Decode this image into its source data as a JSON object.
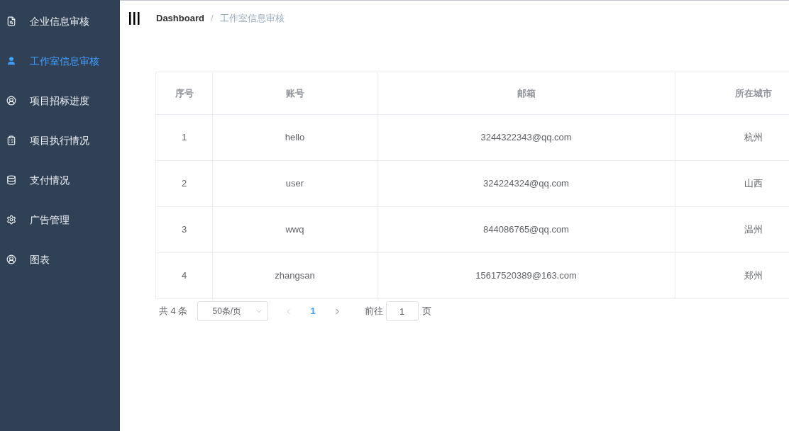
{
  "sidebar": {
    "items": [
      {
        "label": "企业信息审核",
        "selected": false
      },
      {
        "label": "工作室信息审核",
        "selected": true
      },
      {
        "label": "项目招标进度",
        "selected": false
      },
      {
        "label": "项目执行情况",
        "selected": false
      },
      {
        "label": "支付情况",
        "selected": false
      },
      {
        "label": "广告管理",
        "selected": false
      },
      {
        "label": "图表",
        "selected": false
      }
    ]
  },
  "breadcrumb": {
    "items": [
      "Dashboard",
      "工作室信息审核"
    ],
    "separator": "/"
  },
  "table": {
    "columns": [
      "序号",
      "账号",
      "邮箱",
      "所在城市"
    ],
    "rows": [
      [
        "1",
        "hello",
        "3244322343@qq.com",
        "杭州"
      ],
      [
        "2",
        "user",
        "324224324@qq.com",
        "山西"
      ],
      [
        "3",
        "wwq",
        "844086765@qq.com",
        "温州"
      ],
      [
        "4",
        "zhangsan",
        "15617520389@163.com",
        "郑州"
      ]
    ]
  },
  "pagination": {
    "total": "共 4 条",
    "page_size": "50条/页",
    "pages": [
      {
        "label": "1",
        "selected": true
      }
    ],
    "prev_disabled": true,
    "next_disabled": false,
    "goto_label": "前往",
    "goto_value": "1",
    "goto_suffix": "页"
  }
}
